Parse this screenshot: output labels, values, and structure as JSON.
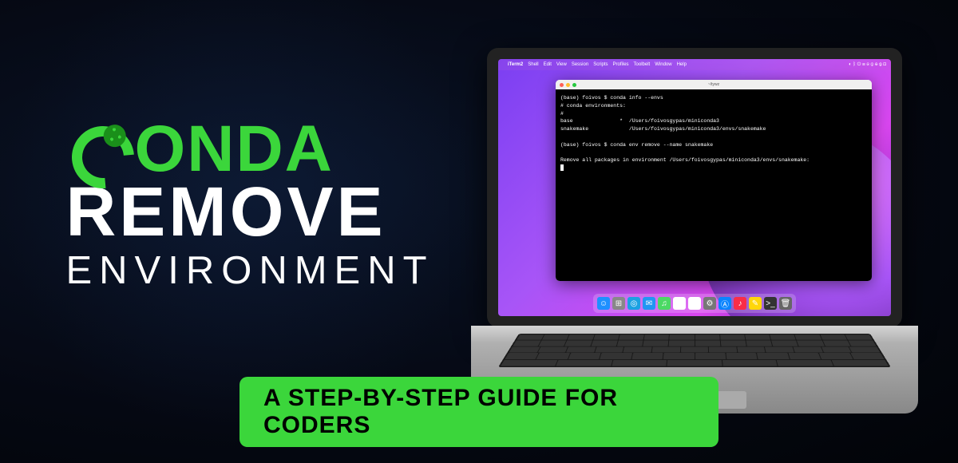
{
  "headline": {
    "brand": "ONDA",
    "line2": "REMOVE",
    "line3": "ENVIRONMENT"
  },
  "badge": "A STEP-BY-STEP GUIDE FOR CODERS",
  "menubar": {
    "app": "iTerm2",
    "items": [
      "Shell",
      "Edit",
      "View",
      "Session",
      "Scripts",
      "Profiles",
      "Toolbelt",
      "Window",
      "Help"
    ],
    "status": "◐ ᛒ ⏻ ☰ ◉ ⓘ ⊕ Ⓐ ⧉"
  },
  "terminal": {
    "title": "~/tywz",
    "lines": {
      "l1": "(base) foivos $ conda info --envs",
      "l2": "# conda environments:",
      "l3": "#",
      "l4": "base               *  /Users/foivosgypas/miniconda3",
      "l5": "snakemake             /Users/foivosgypas/miniconda3/envs/snakemake",
      "l6": "",
      "l7": "(base) foivos $ conda env remove --name snakemake",
      "l8": "",
      "l9": "Remove all packages in environment /Users/foivosgypas/miniconda3/envs/snakemake:"
    }
  },
  "dock": {
    "icons": [
      {
        "name": "finder",
        "bg": "#1e90ff",
        "g": "☺"
      },
      {
        "name": "launchpad",
        "bg": "#888",
        "g": "⊞"
      },
      {
        "name": "safari",
        "bg": "#1ba1e2",
        "g": "◎"
      },
      {
        "name": "mail",
        "bg": "#2196f3",
        "g": "✉"
      },
      {
        "name": "messages",
        "bg": "#4cd964",
        "g": "♫"
      },
      {
        "name": "photos",
        "bg": "#fff",
        "g": "✿"
      },
      {
        "name": "calendar",
        "bg": "#fff",
        "g": "▦"
      },
      {
        "name": "settings",
        "bg": "#777",
        "g": "⚙"
      },
      {
        "name": "appstore",
        "bg": "#0a84ff",
        "g": "Ⓐ"
      },
      {
        "name": "music",
        "bg": "#fa2d48",
        "g": "♪"
      },
      {
        "name": "notes",
        "bg": "#ffd60a",
        "g": "✎"
      },
      {
        "name": "terminal",
        "bg": "#333",
        "g": ">_"
      },
      {
        "name": "trash",
        "bg": "#666",
        "g": "🗑"
      }
    ]
  }
}
